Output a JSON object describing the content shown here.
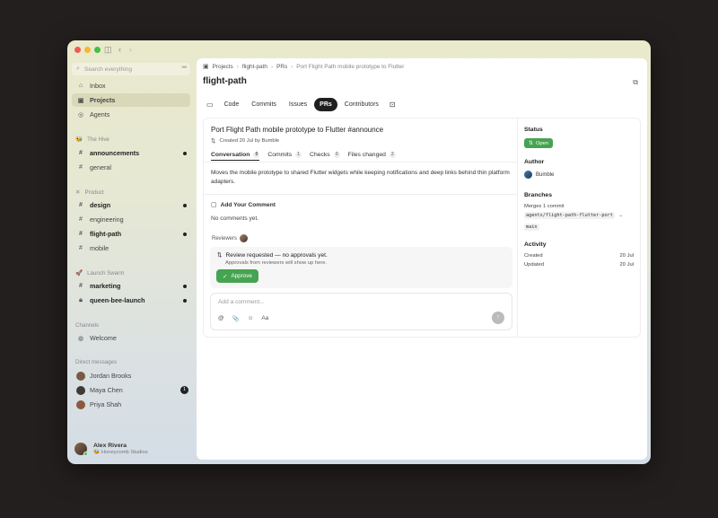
{
  "window": {
    "back_label": "‹",
    "forward_label": "›"
  },
  "sidebar": {
    "search_placeholder": "Search everything",
    "collapse_label": "⏮",
    "top_items": [
      {
        "label": "Inbox",
        "icon": "inbox-icon",
        "glyph": "⌂"
      },
      {
        "label": "Projects",
        "icon": "folder-icon",
        "glyph": "▣"
      },
      {
        "label": "Agents",
        "icon": "agent-icon",
        "glyph": "◎"
      }
    ],
    "sections": [
      {
        "name": "The Hive",
        "icon": "bee-icon",
        "glyph": "🐝"
      },
      {
        "name": "Product",
        "icon": "tools-icon",
        "glyph": "✕"
      },
      {
        "name": "Launch Swarm",
        "icon": "rocket-icon",
        "glyph": "🚀"
      },
      {
        "name": "Channels"
      },
      {
        "name": "Direct messages"
      }
    ],
    "channels": {
      "hive": [
        "announcements",
        "general"
      ],
      "product": [
        "design",
        "engineering",
        "flight-path",
        "mobile"
      ],
      "launch": [
        "marketing",
        "queen-bee-launch"
      ],
      "channels": [
        "Welcome"
      ]
    },
    "dms": [
      {
        "name": "Jordan Brooks",
        "color": "#7a5a45"
      },
      {
        "name": "Maya Chen",
        "color": "#3f3a36",
        "count": "1"
      },
      {
        "name": "Priya Shah",
        "color": "#8b5a3f"
      }
    ],
    "user": {
      "name": "Alex Rivera",
      "org": "Honeycomb Studios"
    }
  },
  "main": {
    "breadcrumb": [
      "Projects",
      "flight-path",
      "PRs",
      "Port Flight Path mobile prototype to Flutter"
    ],
    "title": "flight-path",
    "tabs": [
      "Code",
      "Commits",
      "Issues",
      "PRs",
      "Contributors"
    ],
    "active_tab": "PRs"
  },
  "pr": {
    "title": "Port Flight Path mobile prototype to Flutter #announce",
    "meta": "Created 20 Jul by Bumble",
    "tabs": [
      {
        "label": "Conversation",
        "count": "0"
      },
      {
        "label": "Commits",
        "count": "1"
      },
      {
        "label": "Checks",
        "count": "0"
      },
      {
        "label": "Files changed",
        "count": "2"
      }
    ],
    "description": "Moves the mobile prototype to shared Flutter widgets while keeping notifications and deep links behind thin platform adapters.",
    "add_comment_heading": "Add Your Comment",
    "no_comments": "No comments yet.",
    "reviewers_label": "Reviewers",
    "review_title": "Review requested — no approvals yet.",
    "review_sub": "Approvals from reviewers will show up here.",
    "approve_label": "Approve",
    "comment_placeholder": "Add a comment...",
    "comment_tools": [
      "@",
      "📎",
      "☺",
      "Aa"
    ],
    "send_label": "↑"
  },
  "side": {
    "status_heading": "Status",
    "status": "Open",
    "status_color": "#46a351",
    "author_heading": "Author",
    "author": "Bumble",
    "branches_heading": "Branches",
    "merges": "Merges 1 commit",
    "source_branch": "agents/flight-path-flutter-port",
    "branch_arrow": "→",
    "target_branch": "main",
    "activity_heading": "Activity",
    "created_label": "Created",
    "created_value": "20 Jul",
    "updated_label": "Updated",
    "updated_value": "20 Jul"
  }
}
